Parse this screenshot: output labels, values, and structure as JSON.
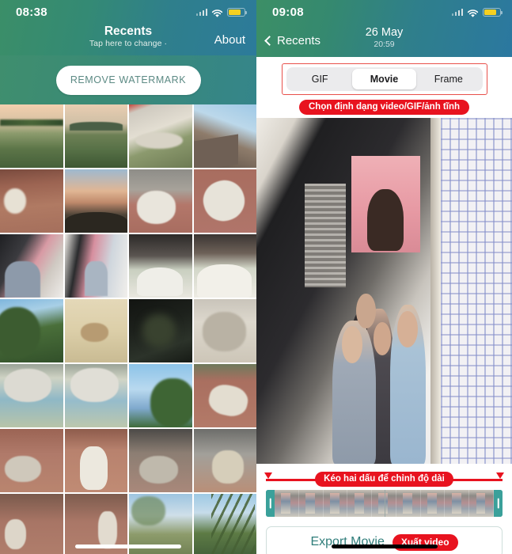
{
  "left_panel": {
    "status_bar": {
      "time": "08:38",
      "signal_icon": "cellular-signal-icon",
      "wifi_icon": "wifi-icon",
      "battery_icon": "battery-icon"
    },
    "header": {
      "title": "Recents",
      "subtitle": "Tap here to change ·",
      "about_label": "About"
    },
    "remove_watermark_label": "REMOVE WATERMARK",
    "grid": {
      "columns": 4,
      "photos": [
        {
          "caption": "Sunset field with trees",
          "style": "ph-sunsetfield"
        },
        {
          "caption": "Green field and hills at dusk",
          "style": "ph-hills"
        },
        {
          "caption": "Miniature rock garden",
          "style": "ph-garden"
        },
        {
          "caption": "Street building with power lines",
          "style": "ph-street"
        },
        {
          "caption": "White dogs on red tile yard",
          "style": "ph-dogs1"
        },
        {
          "caption": "Dusk sky over hill",
          "style": "ph-dusk"
        },
        {
          "caption": "White fluffy dog on tiles",
          "style": "ph-whitedog"
        },
        {
          "caption": "White dog rolling on tiles",
          "style": "ph-dogtile"
        },
        {
          "caption": "Group selfie in front of store",
          "style": "ph-selfie"
        },
        {
          "caption": "Group reflected in shop mirror",
          "style": "ph-mirror"
        },
        {
          "caption": "Birthday cake with candles",
          "style": "ph-cake1"
        },
        {
          "caption": "Birthday cake close up",
          "style": "ph-cake2"
        },
        {
          "caption": "Tree against blue sky",
          "style": "ph-tree"
        },
        {
          "caption": "Cat lying on yellow floor",
          "style": "ph-floorcat"
        },
        {
          "caption": "Dark blurred photo",
          "style": "ph-dark"
        },
        {
          "caption": "Cat resting on tiles",
          "style": "ph-cattile"
        },
        {
          "caption": "White cat sleeping by baskets",
          "style": "ph-catsleep"
        },
        {
          "caption": "White cat eating on patterned tiles",
          "style": "ph-catsleep2"
        },
        {
          "caption": "Tree tops and blue sky",
          "style": "ph-sky"
        },
        {
          "caption": "Dogs lying in the yard",
          "style": "ph-dogyard"
        },
        {
          "caption": "Cat and dogs playing on tiles",
          "style": "ph-dogplay"
        },
        {
          "caption": "Dog standing on tile floor",
          "style": "ph-dogstand"
        },
        {
          "caption": "Gray cat lying down",
          "style": "ph-catgray"
        },
        {
          "caption": "Dog jumping at gate",
          "style": "ph-dogjump"
        },
        {
          "caption": "Group of dogs eating",
          "style": "ph-dogsgroup"
        },
        {
          "caption": "Group of dogs on patio",
          "style": "ph-dogsgroup2"
        },
        {
          "caption": "Open field with clouds",
          "style": "ph-field"
        },
        {
          "caption": "Bamboo against sky",
          "style": "ph-bamboo"
        }
      ]
    }
  },
  "right_panel": {
    "status_bar": {
      "time": "09:08",
      "signal_icon": "cellular-signal-icon",
      "wifi_icon": "wifi-icon",
      "battery_icon": "battery-icon"
    },
    "header": {
      "back_label": "Recents",
      "back_icon": "chevron-left-icon",
      "date": "26 May",
      "time": "20:59"
    },
    "format_segmented_control": {
      "options": [
        "GIF",
        "Movie",
        "Frame"
      ],
      "selected": "Movie",
      "highlight_color": "#e8504b"
    },
    "annotation_format": "Chọn định dạng video/GIF/ảnh tĩnh",
    "preview": {
      "caption": "Four friends taking a photo in front of a shop window"
    },
    "annotation_trim": "Kéo hai dấu để chỉnh độ dài",
    "timeline": {
      "frame_count": 9,
      "left_handle_icon": "trim-handle-icon",
      "right_handle_icon": "trim-handle-icon"
    },
    "export": {
      "label": "Export Movie",
      "badge": "Xuất video"
    }
  },
  "colors": {
    "header_green": "#3b8e68",
    "header_blue": "#2c7a9c",
    "annotation_red": "#e8131f",
    "teal_accent": "#2f7d7a",
    "handle_teal": "#3aa09a"
  }
}
